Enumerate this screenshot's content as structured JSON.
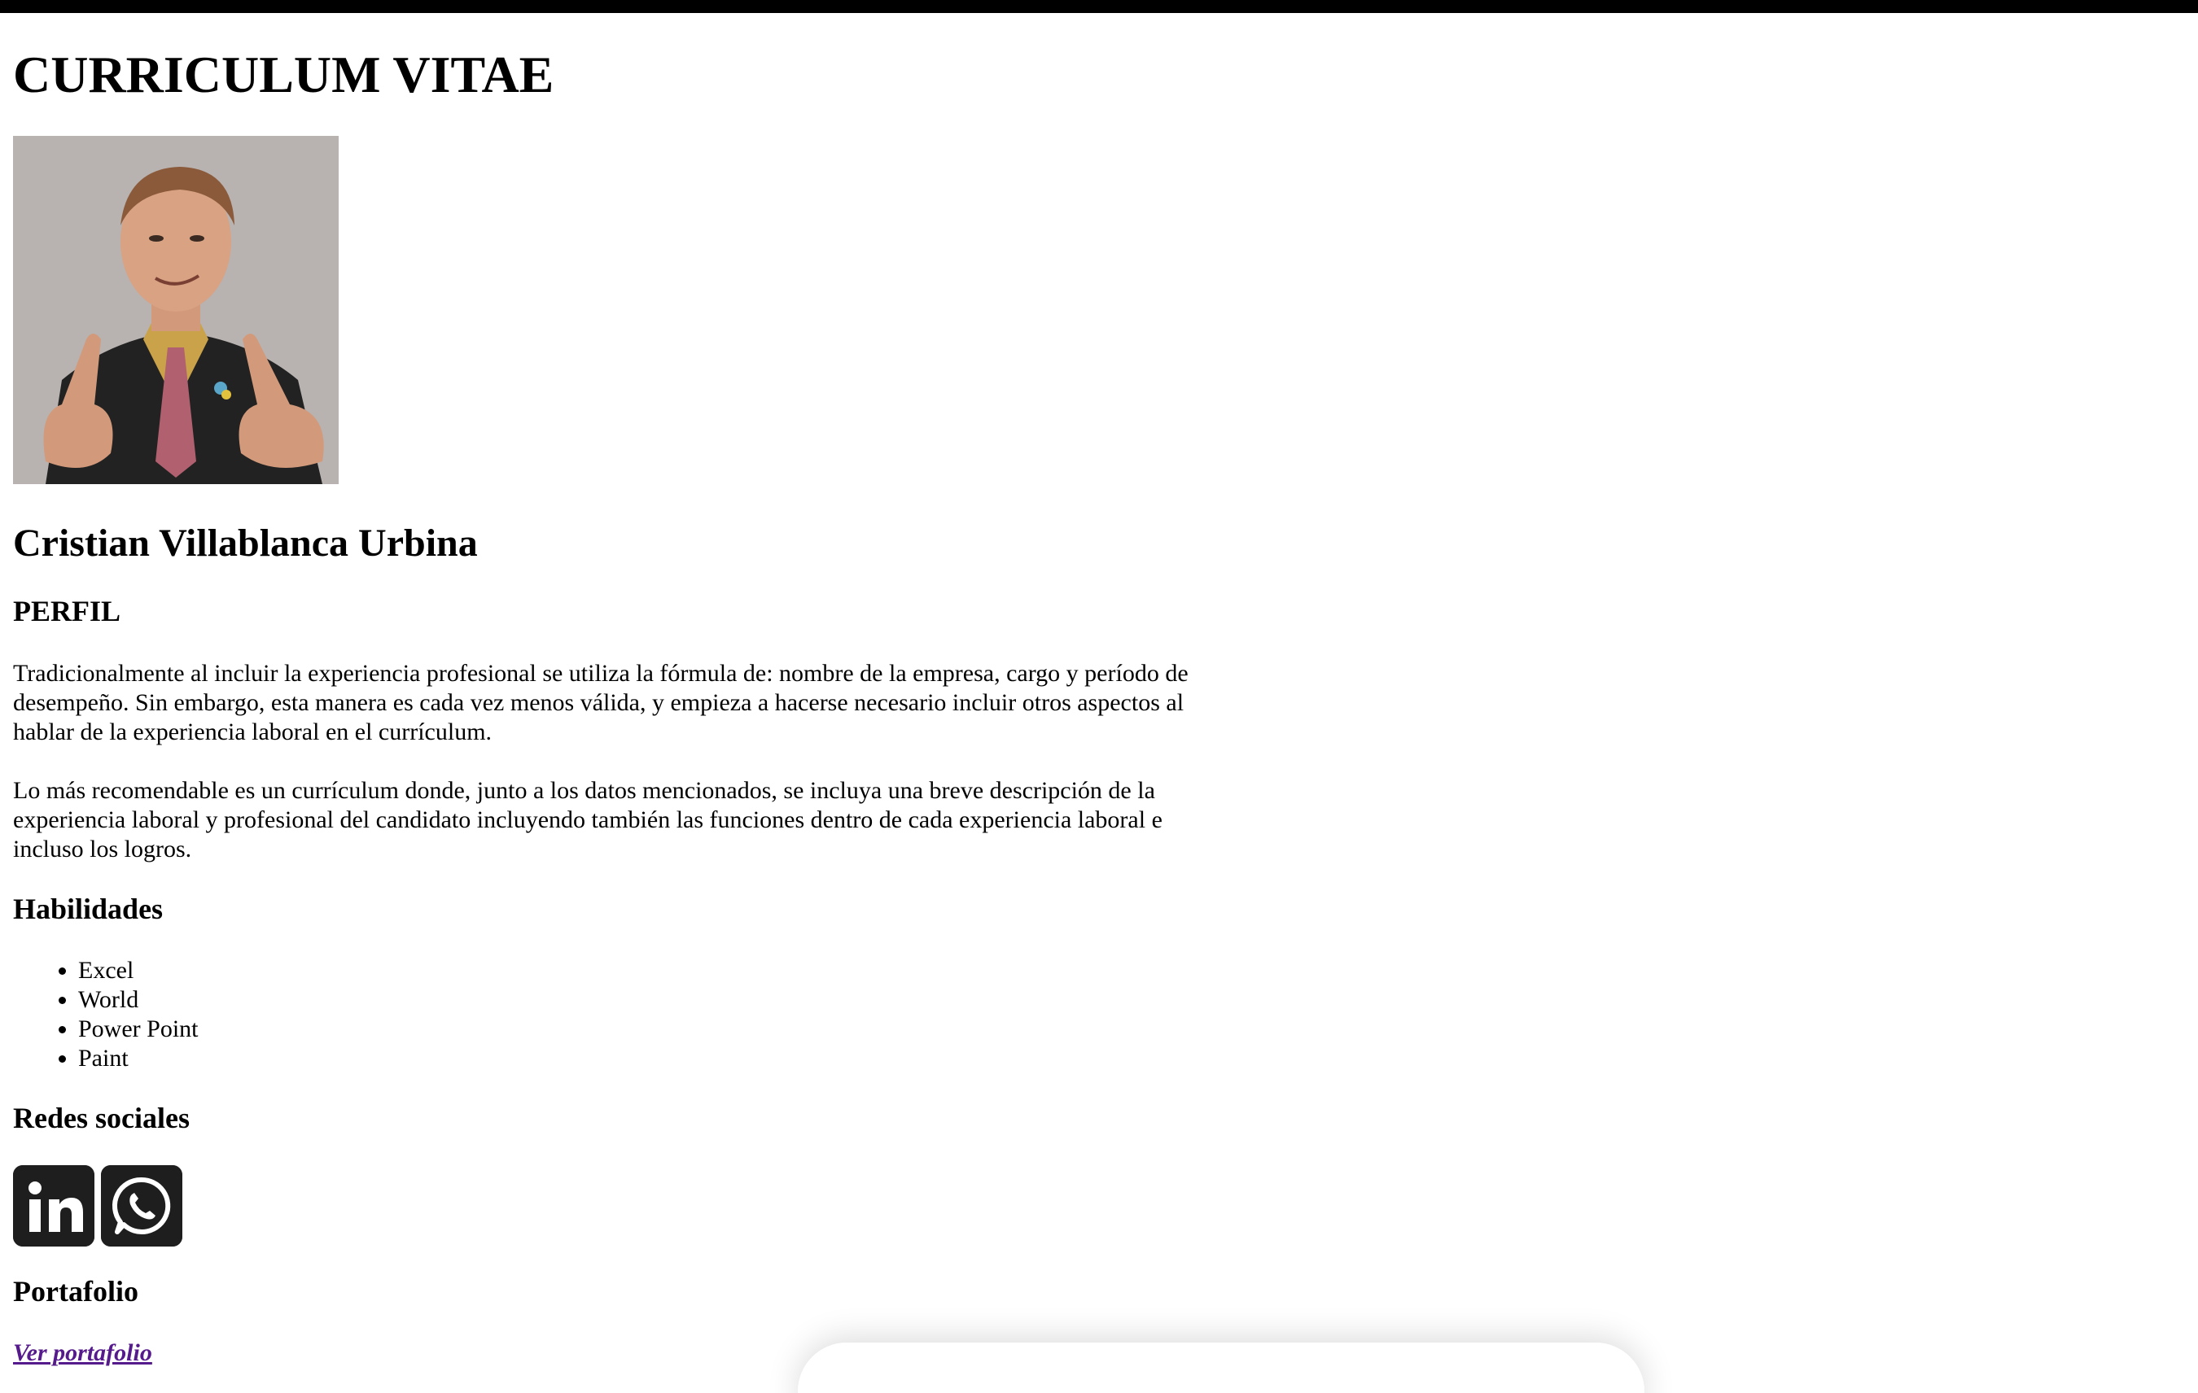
{
  "title": "CURRICULUM VITAE",
  "name": "Cristian Villablanca Urbina",
  "profile": {
    "heading": "PERFIL",
    "paragraphs": [
      "Tradicionalmente al incluir la experiencia profesional se utiliza la fórmula de: nombre de la empresa, cargo y período de desempeño. Sin embargo, esta manera es cada vez menos válida, y empieza a hacerse necesario incluir otros aspectos al hablar de la experiencia laboral en el currículum.",
      "Lo más recomendable es un currículum donde, junto a los datos mencionados, se incluya una breve descripción de la experiencia laboral y profesional del candidato incluyendo también las funciones dentro de cada experiencia laboral e incluso los logros."
    ]
  },
  "skills": {
    "heading": "Habilidades",
    "items": [
      "Excel",
      "World",
      "Power Point",
      "Paint"
    ]
  },
  "social": {
    "heading": "Redes sociales",
    "icons": [
      "linkedin-icon",
      "whatsapp-icon"
    ]
  },
  "portfolio": {
    "heading": "Portafolio",
    "link_label": "Ver portafolio"
  },
  "colors": {
    "visited_link": "#551a8b",
    "icon_background": "#1f1e1f"
  }
}
